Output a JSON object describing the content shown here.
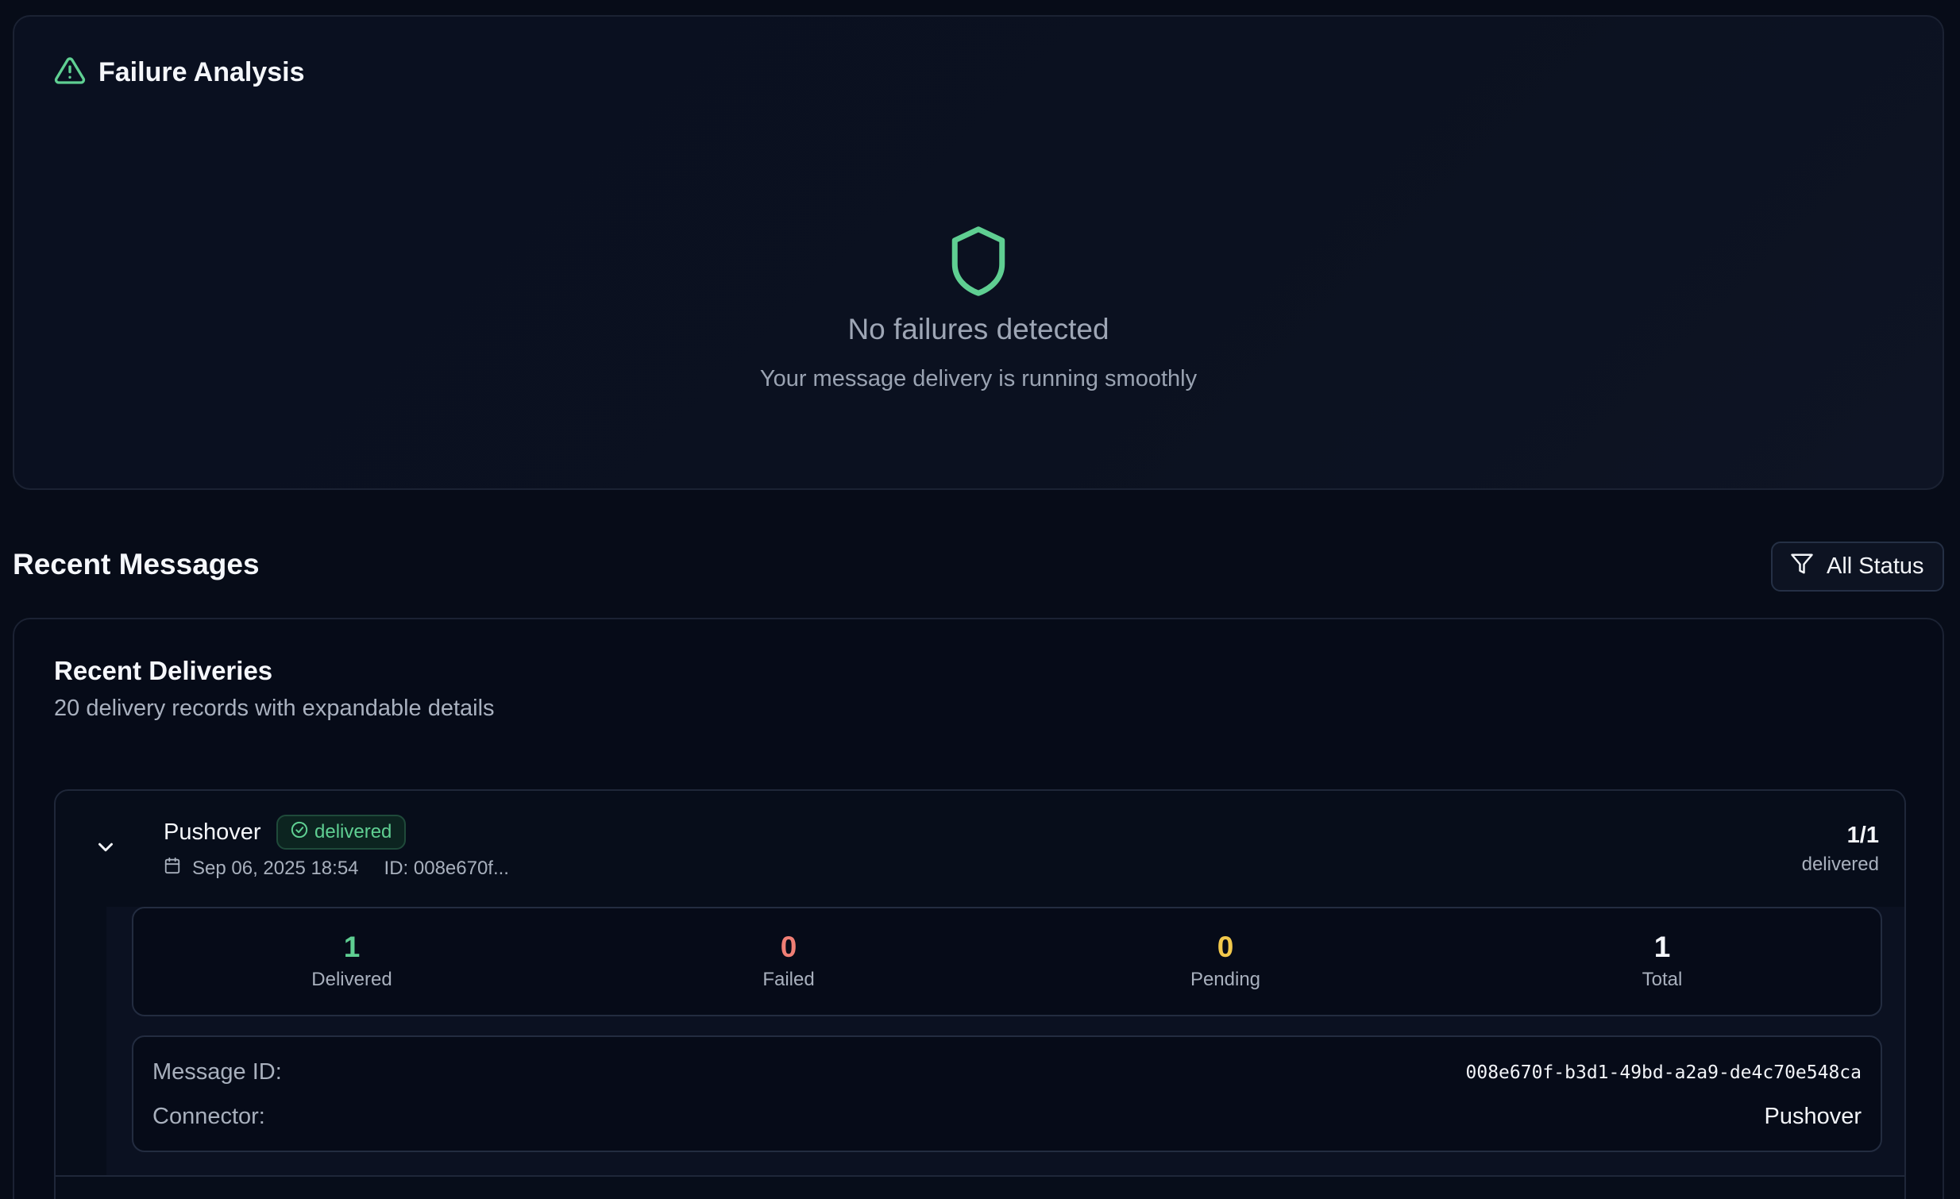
{
  "failure_analysis": {
    "title": "Failure Analysis",
    "empty_title": "No failures detected",
    "empty_subtitle": "Your message delivery is running smoothly"
  },
  "recent_messages": {
    "title": "Recent Messages",
    "filter_label": "All Status"
  },
  "deliveries": {
    "title": "Recent Deliveries",
    "subtitle": "20 delivery records with expandable details",
    "items": [
      {
        "name": "Pushover",
        "status": "delivered",
        "date": "Sep 06, 2025 18:54",
        "id_short": "ID: 008e670f...",
        "count": "1/1",
        "count_label": "delivered",
        "stats": [
          {
            "value": "1",
            "label": "Delivered"
          },
          {
            "value": "0",
            "label": "Failed"
          },
          {
            "value": "0",
            "label": "Pending"
          },
          {
            "value": "1",
            "label": "Total"
          }
        ],
        "details": {
          "message_id_label": "Message ID:",
          "message_id": "008e670f-b3d1-49bd-a2a9-de4c70e548ca",
          "connector_label": "Connector:",
          "connector": "Pushover"
        }
      }
    ]
  },
  "colors": {
    "accent_green": "#5fcf92",
    "failed_red": "#f07f75",
    "pending_yellow": "#f2c94c",
    "background": "#070c18"
  },
  "icons": {
    "failure_header": "alert-triangle-icon",
    "empty_state": "shield-icon",
    "filter": "filter-icon",
    "expand": "chevron-down-icon",
    "status": "check-circle-icon",
    "date": "calendar-icon"
  }
}
